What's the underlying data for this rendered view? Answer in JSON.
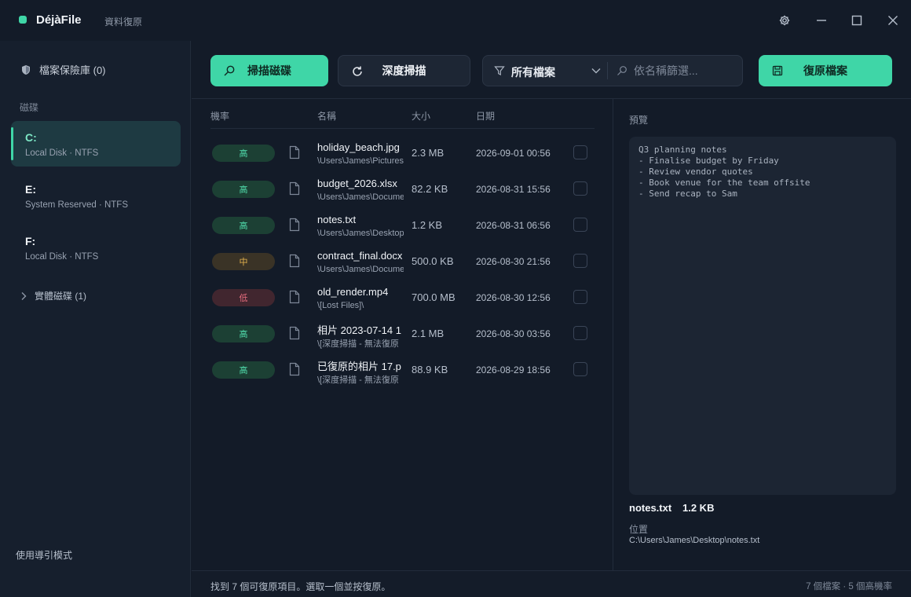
{
  "app": {
    "name": "DéjàFile",
    "subtitle": "資料復原"
  },
  "sidebar": {
    "vault_label": "檔案保險庫 (0)",
    "section_label": "磁碟",
    "drives": [
      {
        "letter": "C:",
        "meta": "Local Disk · NTFS",
        "selected": true
      },
      {
        "letter": "E:",
        "meta": "System Reserved · NTFS",
        "selected": false
      },
      {
        "letter": "F:",
        "meta": "Local Disk · NTFS",
        "selected": false
      }
    ],
    "physical_label": "實體磁碟 (1)",
    "guide_label": "使用導引模式"
  },
  "toolbar": {
    "scan_label": "掃描磁碟",
    "deep_scan_label": "深度掃描",
    "filter_label": "所有檔案",
    "search_placeholder": "依名稱篩選...",
    "recover_label": "復原檔案"
  },
  "table": {
    "headers": {
      "chance": "機率",
      "name": "名稱",
      "size": "大小",
      "date": "日期"
    },
    "rows": [
      {
        "chance": "高",
        "level": "high",
        "name": "holiday_beach.jpg",
        "path": "\\Users\\James\\Pictures",
        "size": "2.3 MB",
        "date": "2026-09-01 00:56"
      },
      {
        "chance": "高",
        "level": "high",
        "name": "budget_2026.xlsx",
        "path": "\\Users\\James\\Documents",
        "size": "82.2 KB",
        "date": "2026-08-31 15:56"
      },
      {
        "chance": "高",
        "level": "high",
        "name": "notes.txt",
        "path": "\\Users\\James\\Desktop",
        "size": "1.2 KB",
        "date": "2026-08-31 06:56"
      },
      {
        "chance": "中",
        "level": "mid",
        "name": "contract_final.docx",
        "path": "\\Users\\James\\Documents",
        "size": "500.0 KB",
        "date": "2026-08-30 21:56"
      },
      {
        "chance": "低",
        "level": "low",
        "name": "old_render.mp4",
        "path": "\\[Lost Files]\\",
        "size": "700.0 MB",
        "date": "2026-08-30 12:56"
      },
      {
        "chance": "高",
        "level": "high",
        "name": "相片 2023-07-14 1",
        "path": "\\[深度掃描 - 無法復原",
        "size": "2.1 MB",
        "date": "2026-08-30 03:56"
      },
      {
        "chance": "高",
        "level": "high",
        "name": "已復原的相片 17.p",
        "path": "\\[深度掃描 - 無法復原",
        "size": "88.9 KB",
        "date": "2026-08-29 18:56"
      }
    ]
  },
  "preview": {
    "title": "預覽",
    "lines": [
      "Q3 planning notes",
      "- Finalise budget by Friday",
      "- Review vendor quotes",
      "- Book venue for the team offsite",
      "- Send recap to Sam"
    ],
    "file_name": "notes.txt",
    "file_size": "1.2 KB",
    "location_label": "位置",
    "location": "C:\\Users\\James\\Desktop\\notes.txt"
  },
  "status": {
    "message": "找到 7 個可復原項目。選取一個並按復原。",
    "summary": "7 個檔案 · 5 個高機率"
  }
}
